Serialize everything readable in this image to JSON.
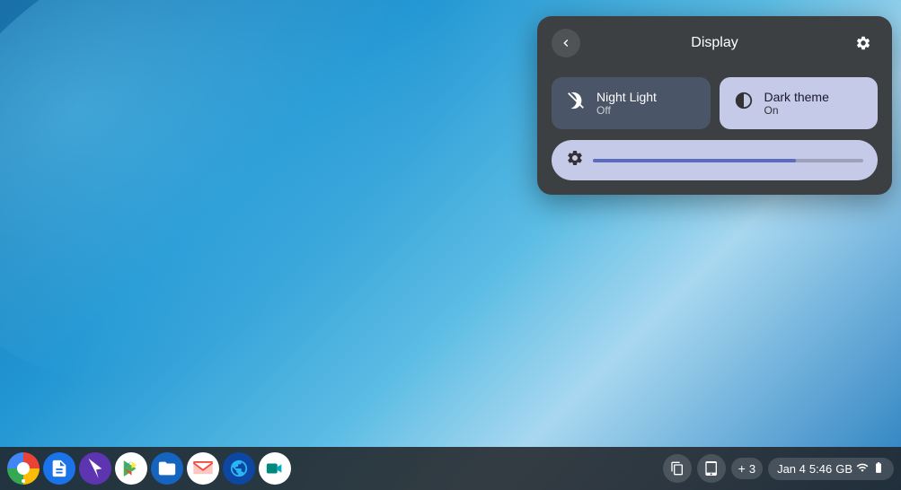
{
  "desktop": {
    "wallpaper_description": "Blue gradient wallpaper"
  },
  "panel": {
    "title": "Display",
    "back_label": "‹",
    "settings_label": "⚙"
  },
  "night_light": {
    "title": "Night Light",
    "subtitle": "Off",
    "active": false
  },
  "dark_theme": {
    "title": "Dark theme",
    "subtitle": "On",
    "active": true
  },
  "brightness": {
    "icon": "⚙",
    "value": 75
  },
  "taskbar": {
    "apps": [
      {
        "name": "Chrome",
        "type": "chrome"
      },
      {
        "name": "Docs",
        "type": "docs"
      },
      {
        "name": "Cursor",
        "type": "cursor"
      },
      {
        "name": "Play Store",
        "type": "play"
      },
      {
        "name": "Files",
        "type": "files"
      },
      {
        "name": "Gmail",
        "type": "gmail"
      },
      {
        "name": "Earth",
        "type": "earth"
      },
      {
        "name": "Meet",
        "type": "meet"
      }
    ],
    "tray": {
      "clipboard_icon": "⧉",
      "tablet_icon": "▭",
      "plus_icon": "+",
      "badge_count": "3",
      "date": "Jan 4",
      "time": "5:46",
      "storage": "GB",
      "wifi_icon": "▾",
      "battery_icon": "▮"
    }
  }
}
